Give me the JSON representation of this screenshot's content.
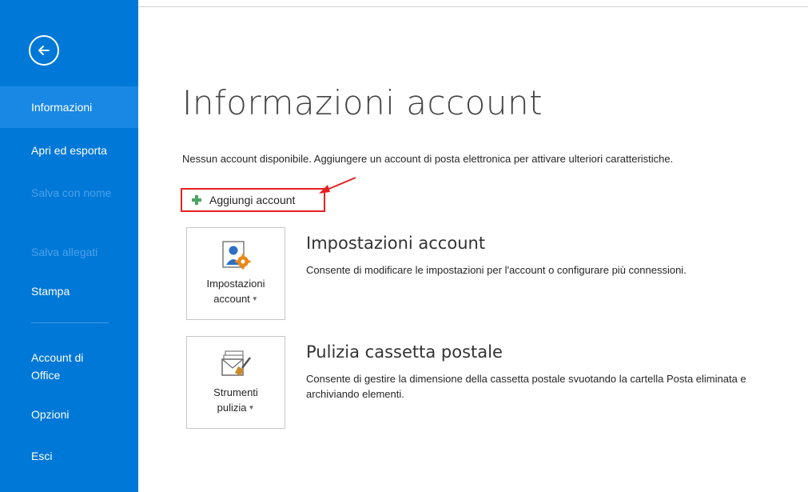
{
  "sidebar": {
    "items": [
      {
        "label": "Informazioni",
        "state": "active"
      },
      {
        "label": "Apri ed esporta",
        "state": "normal"
      },
      {
        "label": "Salva con nome",
        "state": "disabled"
      },
      {
        "label": "Salva allegati",
        "state": "disabled"
      },
      {
        "label": "Stampa",
        "state": "normal"
      },
      {
        "label": "Account di Office",
        "state": "normal"
      },
      {
        "label": "Opzioni",
        "state": "normal"
      },
      {
        "label": "Esci",
        "state": "normal"
      }
    ],
    "back_icon": "back-arrow-circle-icon"
  },
  "main": {
    "title": "Informazioni account",
    "info_text": "Nessun account disponibile. Aggiungere un account di posta elettronica per attivare ulteriori caratteristiche.",
    "add_account_label": "Aggiungi account",
    "sections": [
      {
        "tile_label_line1": "Impostazioni",
        "tile_label_line2": "account",
        "title": "Impostazioni account",
        "description": "Consente di modificare le impostazioni per l'account o configurare più connessioni.",
        "icon": "account-settings-icon"
      },
      {
        "tile_label_line1": "Strumenti",
        "tile_label_line2": "pulizia",
        "title": "Pulizia cassetta postale",
        "description": "Consente di gestire la dimensione della cassetta postale svuotando la cartella Posta eliminata e archiviando elementi.",
        "icon": "cleanup-tools-icon"
      }
    ]
  },
  "colors": {
    "sidebar_bg": "#0078d7",
    "sidebar_active": "#1888e4",
    "highlight_border": "#e62020",
    "plus_green": "#4aa564"
  }
}
